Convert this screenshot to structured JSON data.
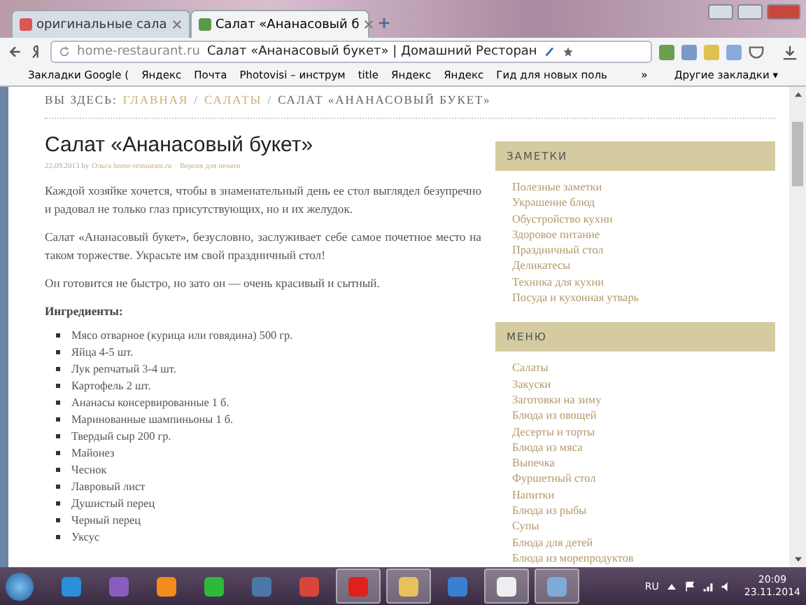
{
  "browser": {
    "tabs": [
      {
        "label": "оригинальные сала",
        "selected": false
      },
      {
        "label": "Салат «Ананасовый б",
        "selected": true
      }
    ],
    "address": {
      "domain": "home-restaurant.ru",
      "title": "Салат «Ананасовый букет» | Домашний Ресторан"
    },
    "bookmarks": [
      "Закладки Google (",
      "Яндекс",
      "Почта",
      "Photovisi – инструм",
      "title",
      "Яндекс",
      "Яндекс",
      "Гид для новых поль"
    ],
    "more_bookmarks": "»",
    "other_bookmarks": "Другие закладки ▾"
  },
  "breadcrumb": {
    "prefix": "ВЫ ЗДЕСЬ:",
    "links": [
      "ГЛАВНАЯ",
      "САЛАТЫ"
    ],
    "separator": "/",
    "current": "САЛАТ «АНАНАСОВЫЙ БУКЕТ»"
  },
  "article": {
    "title": "Салат «Ананасовый букет»",
    "date": "22.09.2013 by",
    "author": "Ольга home-restaurant.ru",
    "sep": "·",
    "print": "Версия для печати",
    "paragraphs": [
      "Каждой хозяйке хочется, чтобы в знаменательный день ее стол выглядел безупречно и радовал не только глаз присутствующих, но и их желудок.",
      "Салат «Ананасовый букет», безусловно, заслуживает себе самое почетное место на таком торжестве. Украсьте им свой праздничный стол!",
      "Он готовится не быстро, но зато он — очень красивый и сытный."
    ],
    "ingredients_heading": "Ингредиенты:",
    "ingredients": [
      "Мясо отварное (курица или говядина) 500 гр.",
      "Яйца 4-5 шт.",
      "Лук репчатый 3-4 шт.",
      "Картофель 2 шт.",
      "Ананасы консервированные 1 б.",
      "Маринованные шампиньоны 1 б.",
      "Твердый сыр 200 гр.",
      "Майонез",
      "Чеснок",
      "Лавровый лист",
      "Душистый перец",
      "Черный перец",
      "Уксус"
    ]
  },
  "sidebar": [
    {
      "heading": "ЗАМЕТКИ",
      "items": [
        "Полезные заметки",
        "Украшение блюд",
        "Обустройство кухни",
        "Здоровое питание",
        "Праздничный стол",
        "Деликатесы",
        "Техника для кухни",
        "Посуда и кухонная утварь"
      ]
    },
    {
      "heading": "МЕНЮ",
      "items": [
        "Салаты",
        "Закуски",
        "Заготовки на зиму",
        "Блюда из овощей",
        "Десерты и торты",
        "Блюда из мяса",
        "Выпечка",
        "Фуршетный стол",
        "Напитки",
        "Блюда из рыбы",
        "Супы",
        "Блюда для детей",
        "Блюда из морепродуктов"
      ]
    }
  ],
  "taskbar": {
    "apps": [
      {
        "kind": "ie",
        "running": false
      },
      {
        "kind": "vs",
        "running": false
      },
      {
        "kind": "ok",
        "running": false
      },
      {
        "kind": "a",
        "running": false
      },
      {
        "kind": "vk",
        "running": false
      },
      {
        "kind": "chrome",
        "running": false
      },
      {
        "kind": "yandex",
        "running": true
      },
      {
        "kind": "folder",
        "running": true
      },
      {
        "kind": "speaker",
        "running": false
      },
      {
        "kind": "cards",
        "running": true
      },
      {
        "kind": "picture",
        "running": true
      }
    ],
    "language": "RU",
    "time": "20:09",
    "date": "23.11.2014"
  }
}
